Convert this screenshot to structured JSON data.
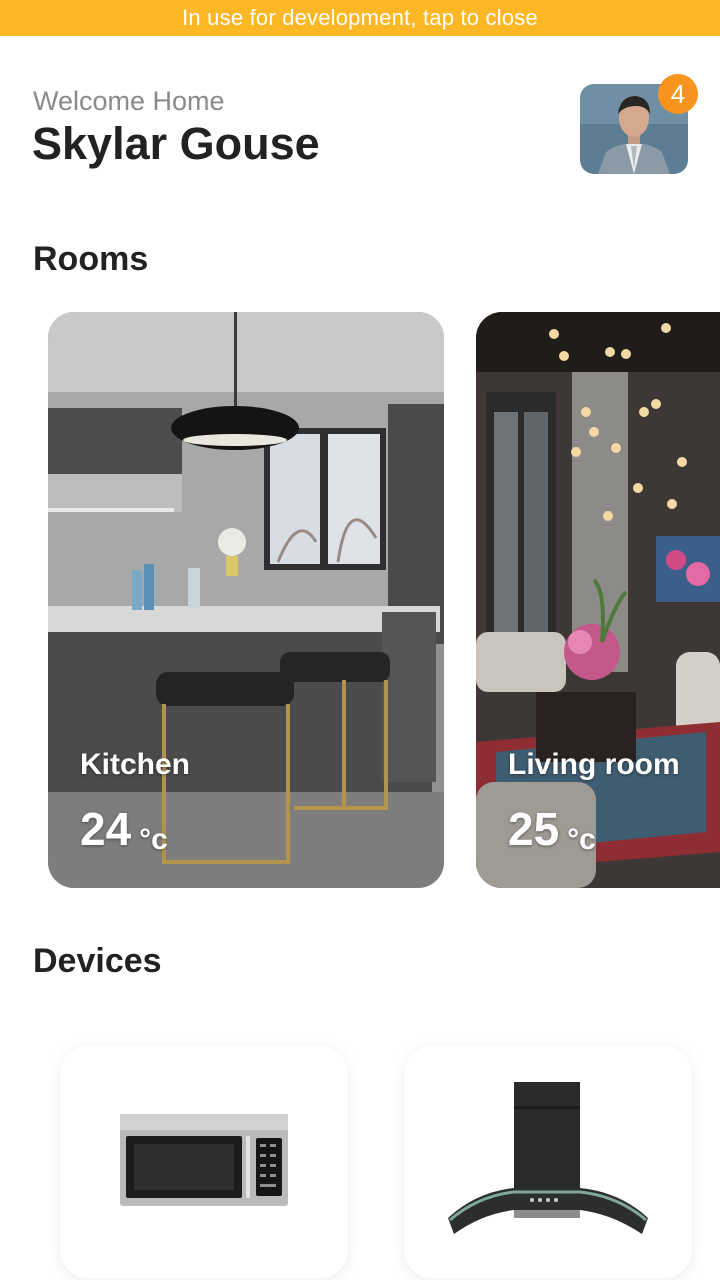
{
  "banner": {
    "text": "In use for development, tap to close"
  },
  "header": {
    "welcome": "Welcome Home",
    "user_name": "Skylar Gouse",
    "notification_count": "4"
  },
  "rooms": {
    "title": "Rooms",
    "items": [
      {
        "name": "Kitchen",
        "temperature": "24",
        "unit": "°c"
      },
      {
        "name": "Living room",
        "temperature": "25",
        "unit": "°c"
      }
    ]
  },
  "devices": {
    "title": "Devices",
    "items": [
      {
        "icon": "microwave-icon"
      },
      {
        "icon": "range-hood-icon"
      }
    ]
  },
  "colors": {
    "banner": "#fbb724",
    "badge": "#f7941d",
    "text_primary": "#222222",
    "text_secondary": "#8a8a8a"
  }
}
